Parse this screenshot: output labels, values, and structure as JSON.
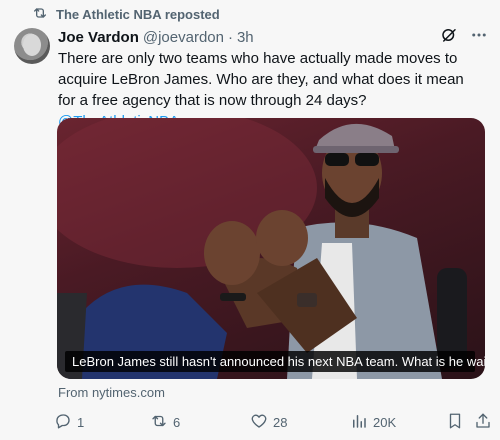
{
  "repost": {
    "label": "The Athletic NBA reposted",
    "icon": "repost-icon"
  },
  "author": {
    "name": "Joe Vardon",
    "handle": "@joevardon",
    "separator": "·",
    "time": "3h"
  },
  "header_icons": [
    "grok-icon",
    "more-icon"
  ],
  "tweet": {
    "text": "There are only two teams who have actually made moves to acquire LeBron James. Who are they, and what does it mean for a free agency that is now through 24 days? ",
    "mention": "@TheAthleticNBA"
  },
  "media": {
    "caption": "LeBron James still hasn't announced his next NBA team. What is he waiting for?"
  },
  "source": "From nytimes.com",
  "actions": {
    "replies": "1",
    "reposts": "6",
    "likes": "28",
    "views": "20K"
  },
  "colors": {
    "background": "#f7f7f7",
    "text": "#0f1419",
    "secondary": "#536471",
    "link": "#1d9bf0"
  }
}
